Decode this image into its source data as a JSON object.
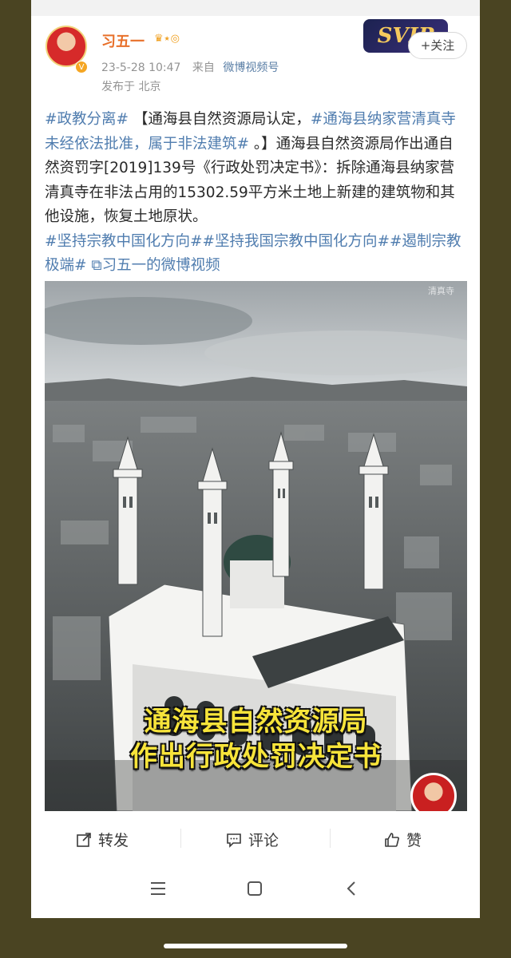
{
  "post": {
    "username": "习五一",
    "user_badges": "♛⭑◎",
    "timestamp": "23-5-28 10:47",
    "source_prefix": "来自",
    "source": "微博视频号",
    "location": "发布于 北京",
    "svip_label": "SVIP",
    "follow_label": "+关注",
    "text": {
      "tag1": "#政教分离#",
      "t1": " 【通海县自然资源局认定，",
      "tag2": "#通海县纳家营清真寺未经依法批准，属于非法建筑#",
      "t2": " 。】通海县自然资源局作出通自然资罚字[2019]139号《行政处罚决定书》：拆除通海县纳家营清真寺在非法占用的15302.59平方米土地上新建的建筑物和其他设施，恢复土地原状。",
      "tag3": "#坚持宗教中国化方向##坚持我国宗教中国化方向##遏制宗教极端#",
      "link": " ⧉习五一的微博视频"
    }
  },
  "video": {
    "caption_line1": "通海县自然资源局",
    "caption_line2": "作出行政处罚决定书",
    "watermark": "清真寺"
  },
  "actions": {
    "repost": "转发",
    "comment": "评论",
    "like": "赞"
  },
  "colors": {
    "link_blue": "#507daf",
    "username_orange": "#e8702a",
    "caption_yellow": "#f7e43a"
  },
  "icons": [
    "repost-icon",
    "comment-icon",
    "like-icon",
    "menu-icon",
    "home-icon",
    "back-icon"
  ]
}
